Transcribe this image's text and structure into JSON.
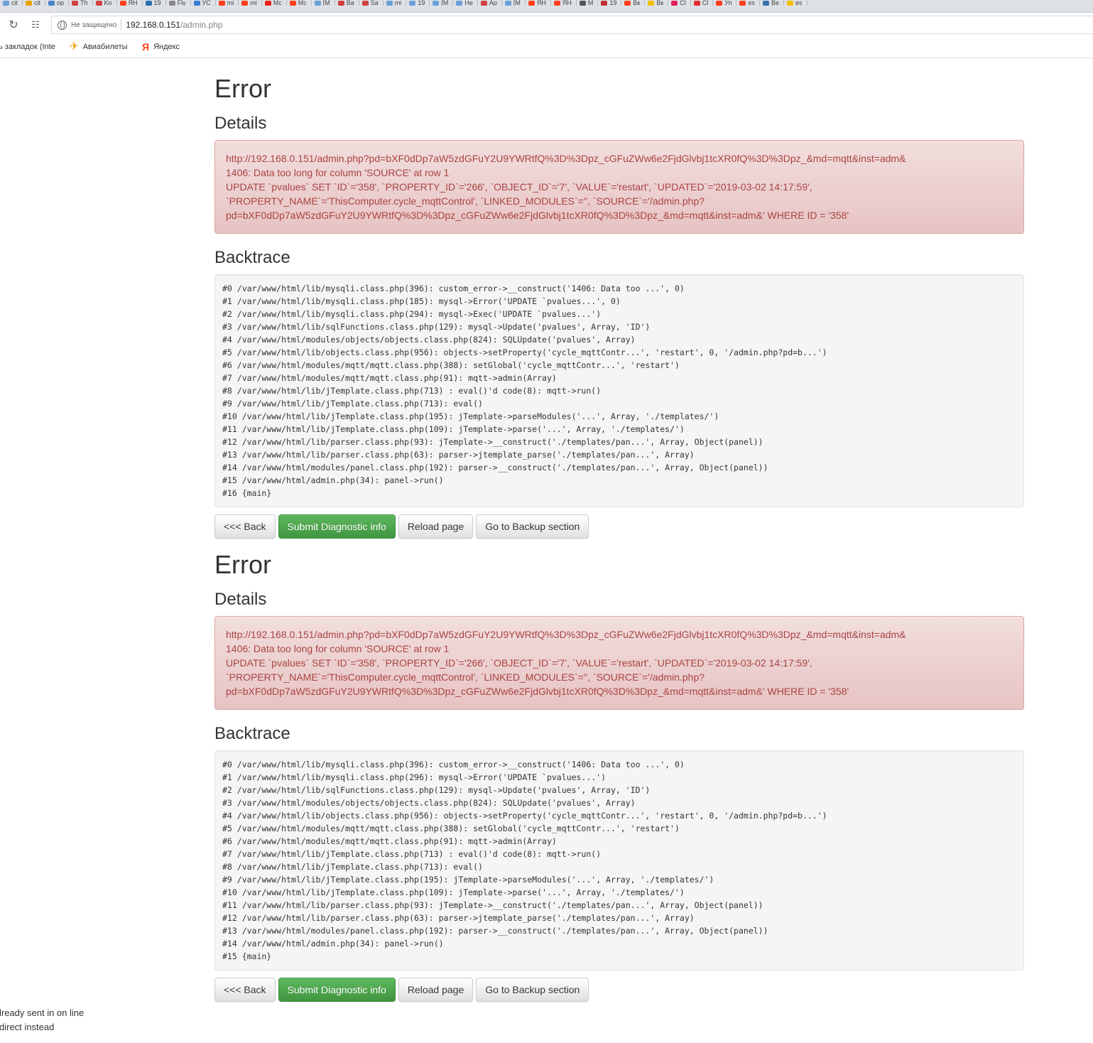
{
  "browser": {
    "tabs": [
      {
        "label": "cit",
        "color": "#6aa0d8"
      },
      {
        "label": "cit",
        "color": "#e8a400"
      },
      {
        "label": "op",
        "color": "#4a86c8"
      },
      {
        "label": "Th",
        "color": "#d04040"
      },
      {
        "label": "Ko",
        "color": "#d04040"
      },
      {
        "label": "ЯН",
        "color": "#fc3f1d"
      },
      {
        "label": "19",
        "color": "#2a6fb0"
      },
      {
        "label": "Fly",
        "color": "#888888"
      },
      {
        "label": "УС",
        "color": "#3a7bd5"
      },
      {
        "label": "mi",
        "color": "#fc3f1d"
      },
      {
        "label": "mi",
        "color": "#fc3f1d"
      },
      {
        "label": "Mc",
        "color": "#e62117"
      },
      {
        "label": "Mc",
        "color": "#fc3f1d"
      },
      {
        "label": "[M",
        "color": "#6aa0d8"
      },
      {
        "label": "Ba",
        "color": "#d04040"
      },
      {
        "label": "Sa",
        "color": "#d04040"
      },
      {
        "label": "mi",
        "color": "#6aa0d8"
      },
      {
        "label": "19",
        "color": "#6aa0d8"
      },
      {
        "label": "[M",
        "color": "#6aa0d8"
      },
      {
        "label": "He",
        "color": "#6aa0d8"
      },
      {
        "label": "Ap",
        "color": "#d04040"
      },
      {
        "label": "[M",
        "color": "#6aa0d8"
      },
      {
        "label": "ЯН",
        "color": "#fc3f1d"
      },
      {
        "label": "ЯН",
        "color": "#fc3f1d"
      },
      {
        "label": "M",
        "color": "#555555"
      },
      {
        "label": "19",
        "color": "#c03030"
      },
      {
        "label": "Вк",
        "color": "#fc3f1d"
      },
      {
        "label": "Вк",
        "color": "#f0c000"
      },
      {
        "label": "Cl",
        "color": "#e0205a"
      },
      {
        "label": "Cl",
        "color": "#e03030"
      },
      {
        "label": "Уп",
        "color": "#fc3f1d"
      },
      {
        "label": "es",
        "color": "#fc3f1d"
      },
      {
        "label": "Be",
        "color": "#3a6fb0"
      },
      {
        "label": "es",
        "color": "#f0c000"
      }
    ],
    "address": {
      "secure_label": "Не защищено",
      "host": "192.168.0.151",
      "path": "/admin.php"
    },
    "bookmarks": {
      "truncated": "ь закладок (Inte",
      "avia": "Авиабилеты",
      "yandex": "Яндекс"
    }
  },
  "errors": [
    {
      "title": "Error",
      "details_heading": "Details",
      "details": [
        "http://192.168.0.151/admin.php?pd=bXF0dDp7aW5zdGFuY2U9YWRtfQ%3D%3Dpz_cGFuZWw6e2FjdGlvbj1tcXR0fQ%3D%3Dpz_&md=mqtt&inst=adm&",
        "1406: Data too long for column 'SOURCE' at row 1",
        "UPDATE `pvalues` SET `ID`='358', `PROPERTY_ID`='266', `OBJECT_ID`='7', `VALUE`='restart', `UPDATED`='2019-03-02 14:17:59',",
        "`PROPERTY_NAME`='ThisComputer.cycle_mqttControl', `LINKED_MODULES`='', `SOURCE`='/admin.php?",
        "pd=bXF0dDp7aW5zdGFuY2U9YWRtfQ%3D%3Dpz_cGFuZWw6e2FjdGlvbj1tcXR0fQ%3D%3Dpz_&md=mqtt&inst=adm&' WHERE ID = '358'"
      ],
      "backtrace_heading": "Backtrace",
      "backtrace": [
        "#0 /var/www/html/lib/mysqli.class.php(396): custom_error->__construct('1406: Data too ...', 0)",
        "#1 /var/www/html/lib/mysqli.class.php(185): mysql->Error('UPDATE `pvalues...', 0)",
        "#2 /var/www/html/lib/mysqli.class.php(294): mysql->Exec('UPDATE `pvalues...')",
        "#3 /var/www/html/lib/sqlFunctions.class.php(129): mysql->Update('pvalues', Array, 'ID')",
        "#4 /var/www/html/modules/objects/objects.class.php(824): SQLUpdate('pvalues', Array)",
        "#5 /var/www/html/lib/objects.class.php(956): objects->setProperty('cycle_mqttContr...', 'restart', 0, '/admin.php?pd=b...')",
        "#6 /var/www/html/modules/mqtt/mqtt.class.php(388): setGlobal('cycle_mqttContr...', 'restart')",
        "#7 /var/www/html/modules/mqtt/mqtt.class.php(91): mqtt->admin(Array)",
        "#8 /var/www/html/lib/jTemplate.class.php(713) : eval()'d code(8): mqtt->run()",
        "#9 /var/www/html/lib/jTemplate.class.php(713): eval()",
        "#10 /var/www/html/lib/jTemplate.class.php(195): jTemplate->parseModules('...', Array, './templates/')",
        "#11 /var/www/html/lib/jTemplate.class.php(109): jTemplate->parse('...', Array, './templates/')",
        "#12 /var/www/html/lib/parser.class.php(93): jTemplate->__construct('./templates/pan...', Array, Object(panel))",
        "#13 /var/www/html/lib/parser.class.php(63): parser->jtemplate_parse('./templates/pan...', Array)",
        "#14 /var/www/html/modules/panel.class.php(192): parser->__construct('./templates/pan...', Array, Object(panel))",
        "#15 /var/www/html/admin.php(34): panel->run()",
        "#16 {main}"
      ],
      "buttons": {
        "back": "<<< Back",
        "submit": "Submit Diagnostic info",
        "reload": "Reload page",
        "backup": "Go to Backup section"
      }
    },
    {
      "title": "Error",
      "details_heading": "Details",
      "details": [
        "http://192.168.0.151/admin.php?pd=bXF0dDp7aW5zdGFuY2U9YWRtfQ%3D%3Dpz_cGFuZWw6e2FjdGlvbj1tcXR0fQ%3D%3Dpz_&md=mqtt&inst=adm&",
        "1406: Data too long for column 'SOURCE' at row 1",
        "UPDATE `pvalues` SET `ID`='358', `PROPERTY_ID`='266', `OBJECT_ID`='7', `VALUE`='restart', `UPDATED`='2019-03-02 14:17:59',",
        "`PROPERTY_NAME`='ThisComputer.cycle_mqttControl', `LINKED_MODULES`='', `SOURCE`='/admin.php?",
        "pd=bXF0dDp7aW5zdGFuY2U9YWRtfQ%3D%3Dpz_cGFuZWw6e2FjdGlvbj1tcXR0fQ%3D%3Dpz_&md=mqtt&inst=adm&' WHERE ID = '358'"
      ],
      "backtrace_heading": "Backtrace",
      "backtrace": [
        "#0 /var/www/html/lib/mysqli.class.php(396): custom_error->__construct('1406: Data too ...', 0)",
        "#1 /var/www/html/lib/mysqli.class.php(296): mysql->Error('UPDATE `pvalues...')",
        "#2 /var/www/html/lib/sqlFunctions.class.php(129): mysql->Update('pvalues', Array, 'ID')",
        "#3 /var/www/html/modules/objects/objects.class.php(824): SQLUpdate('pvalues', Array)",
        "#4 /var/www/html/lib/objects.class.php(956): objects->setProperty('cycle_mqttContr...', 'restart', 0, '/admin.php?pd=b...')",
        "#5 /var/www/html/modules/mqtt/mqtt.class.php(388): setGlobal('cycle_mqttContr...', 'restart')",
        "#6 /var/www/html/modules/mqtt/mqtt.class.php(91): mqtt->admin(Array)",
        "#7 /var/www/html/lib/jTemplate.class.php(713) : eval()'d code(8): mqtt->run()",
        "#8 /var/www/html/lib/jTemplate.class.php(713): eval()",
        "#9 /var/www/html/lib/jTemplate.class.php(195): jTemplate->parseModules('...', Array, './templates/')",
        "#10 /var/www/html/lib/jTemplate.class.php(109): jTemplate->parse('...', Array, './templates/')",
        "#11 /var/www/html/lib/parser.class.php(93): jTemplate->__construct('./templates/pan...', Array, Object(panel))",
        "#12 /var/www/html/lib/parser.class.php(63): parser->jtemplate_parse('./templates/pan...', Array)",
        "#13 /var/www/html/modules/panel.class.php(192): parser->__construct('./templates/pan...', Array, Object(panel))",
        "#14 /var/www/html/admin.php(34): panel->run()",
        "#15 {main}"
      ],
      "buttons": {
        "back": "<<< Back",
        "submit": "Submit Diagnostic info",
        "reload": "Reload page",
        "backup": "Go to Backup section"
      }
    }
  ],
  "footer": {
    "line1": "lready sent in on line",
    "line2": "direct instead"
  }
}
